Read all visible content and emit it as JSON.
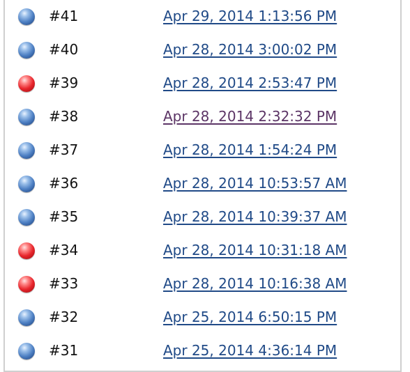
{
  "colors": {
    "link": "#204a87",
    "visited_link": "#5c3566",
    "status_blue": "#4f81c4",
    "status_red": "#e8262c"
  },
  "builds": [
    {
      "number": "#41",
      "date": "Apr 29, 2014 1:13:56 PM",
      "status": "blue",
      "status_icon": "blue-ball-icon",
      "visited": false
    },
    {
      "number": "#40",
      "date": "Apr 28, 2014 3:00:02 PM",
      "status": "blue",
      "status_icon": "blue-ball-icon",
      "visited": false
    },
    {
      "number": "#39",
      "date": "Apr 28, 2014 2:53:47 PM",
      "status": "red",
      "status_icon": "red-ball-icon",
      "visited": false
    },
    {
      "number": "#38",
      "date": "Apr 28, 2014 2:32:32 PM",
      "status": "blue",
      "status_icon": "blue-ball-icon",
      "visited": true
    },
    {
      "number": "#37",
      "date": "Apr 28, 2014 1:54:24 PM",
      "status": "blue",
      "status_icon": "blue-ball-icon",
      "visited": false
    },
    {
      "number": "#36",
      "date": "Apr 28, 2014 10:53:57 AM",
      "status": "blue",
      "status_icon": "blue-ball-icon",
      "visited": false
    },
    {
      "number": "#35",
      "date": "Apr 28, 2014 10:39:37 AM",
      "status": "blue",
      "status_icon": "blue-ball-icon",
      "visited": false
    },
    {
      "number": "#34",
      "date": "Apr 28, 2014 10:31:18 AM",
      "status": "red",
      "status_icon": "red-ball-icon",
      "visited": false
    },
    {
      "number": "#33",
      "date": "Apr 28, 2014 10:16:38 AM",
      "status": "red",
      "status_icon": "red-ball-icon",
      "visited": false
    },
    {
      "number": "#32",
      "date": "Apr 25, 2014 6:50:15 PM",
      "status": "blue",
      "status_icon": "blue-ball-icon",
      "visited": false
    },
    {
      "number": "#31",
      "date": "Apr 25, 2014 4:36:14 PM",
      "status": "blue",
      "status_icon": "blue-ball-icon",
      "visited": false
    }
  ]
}
